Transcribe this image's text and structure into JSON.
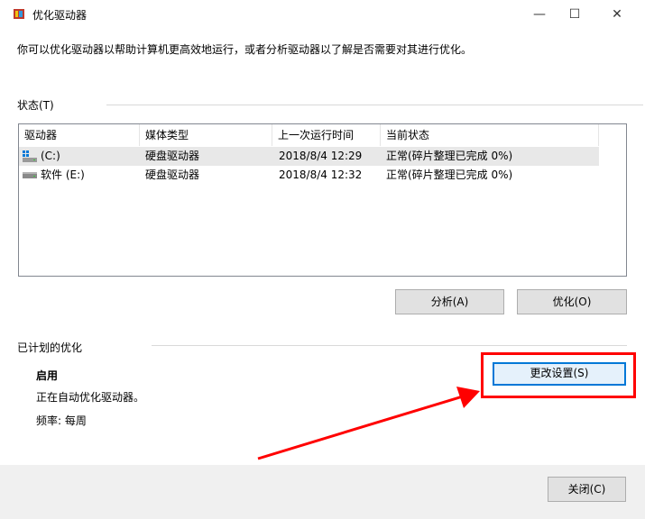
{
  "window": {
    "title": "优化驱动器",
    "controls": {
      "minimize": "—",
      "maximize": "☐",
      "close": "✕"
    }
  },
  "intro": "你可以优化驱动器以帮助计算机更高效地运行，或者分析驱动器以了解是否需要对其进行优化。",
  "status": {
    "label": "状态(T)",
    "columns": [
      "驱动器",
      "媒体类型",
      "上一次运行时间",
      "当前状态"
    ],
    "rows": [
      {
        "drive": "(C:)",
        "media": "硬盘驱动器",
        "last_run": "2018/8/4 12:29",
        "state": "正常(碎片整理已完成 0%)",
        "icon": "windows-drive-icon",
        "selected": true
      },
      {
        "drive": "软件 (E:)",
        "media": "硬盘驱动器",
        "last_run": "2018/8/4 12:32",
        "state": "正常(碎片整理已完成 0%)",
        "icon": "hard-drive-icon",
        "selected": false
      }
    ],
    "analyze_label": "分析(A)",
    "optimize_label": "优化(O)"
  },
  "scheduled": {
    "label": "已计划的优化",
    "enabled_label": "启用",
    "description": "正在自动优化驱动器。",
    "frequency": "频率: 每周",
    "change_settings_label": "更改设置(S)"
  },
  "footer": {
    "close_label": "关闭(C)"
  },
  "colors": {
    "accent": "#0078d7",
    "annotation": "#ff0000"
  }
}
